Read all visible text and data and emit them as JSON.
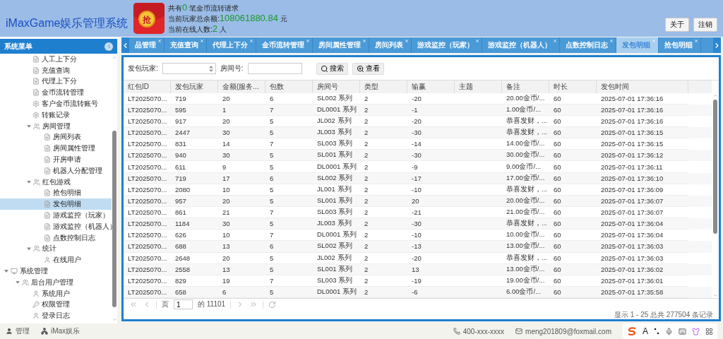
{
  "header": {
    "title": "iMaxGame娱乐管理系统",
    "logo_char": "抢",
    "info": [
      {
        "prefix": "共有",
        "value": "0",
        "suffix": "笔金币流转请求"
      },
      {
        "prefix": "当前玩家总余额:",
        "value": "108061880.84",
        "suffix": "元"
      },
      {
        "prefix": "当前在线人数:",
        "value": "2",
        "suffix": "人"
      }
    ],
    "buttons": [
      "关于",
      "注销"
    ]
  },
  "sidebar": {
    "title": "系统菜单",
    "tree": [
      {
        "children": [
          {
            "label": "人工上下分",
            "kind": "page"
          },
          {
            "label": "充值查询",
            "kind": "page"
          },
          {
            "label": "代理上下分",
            "kind": "page"
          },
          {
            "label": "金币流转管理",
            "kind": "page"
          },
          {
            "label": "客户金币流转账号",
            "kind": "cogs"
          },
          {
            "label": "转账记录",
            "kind": "cogs"
          },
          {
            "label": "房间管理",
            "kind": "group",
            "expanded": true,
            "children": [
              {
                "label": "房间列表",
                "kind": "page",
                "selected": false
              },
              {
                "label": "房间属性管理",
                "kind": "page",
                "selected": false
              },
              {
                "label": "开房申请",
                "kind": "page",
                "selected": false
              },
              {
                "label": "机器人分配管理",
                "kind": "page",
                "selected": false
              }
            ]
          },
          {
            "label": "红包游戏",
            "kind": "group",
            "expanded": true,
            "children": [
              {
                "label": "抢包明细",
                "kind": "page",
                "selected": false
              },
              {
                "label": "发包明细",
                "kind": "page",
                "selected": true
              },
              {
                "label": "游戏监控（玩家）",
                "kind": "page",
                "selected": false
              },
              {
                "label": "游戏监控（机器人）",
                "kind": "page",
                "selected": false
              },
              {
                "label": "点数控制日志",
                "kind": "page",
                "selected": false
              }
            ]
          },
          {
            "label": "统计",
            "kind": "group",
            "expanded": true,
            "children": [
              {
                "label": "在线用户",
                "kind": "user",
                "selected": false
              }
            ]
          }
        ]
      },
      {
        "label": "系统管理",
        "kind": "system",
        "expanded": true,
        "children": [
          {
            "label": "后台用户管理",
            "kind": "group",
            "expanded": true,
            "children": [
              {
                "label": "系统用户",
                "kind": "user",
                "selected": false
              },
              {
                "label": "权限管理",
                "kind": "key",
                "selected": false
              },
              {
                "label": "登录日志",
                "kind": "user",
                "selected": false
              }
            ]
          }
        ]
      }
    ]
  },
  "tabs": [
    {
      "label": "品管理",
      "selected": false
    },
    {
      "label": "充值查询",
      "selected": false
    },
    {
      "label": "代理上下分",
      "selected": false
    },
    {
      "label": "金币流转管理",
      "selected": false
    },
    {
      "label": "房间属性管理",
      "selected": false
    },
    {
      "label": "房间列表",
      "selected": false
    },
    {
      "label": "游戏监控（玩家）",
      "selected": false
    },
    {
      "label": "游戏监控（机器人）",
      "selected": false
    },
    {
      "label": "点数控制日志",
      "selected": false
    },
    {
      "label": "发包明细",
      "selected": true
    },
    {
      "label": "抢包明细",
      "selected": false
    }
  ],
  "filters": {
    "player_label": "发包玩家:",
    "room_label": "房间号:",
    "buttons": [
      {
        "label": "搜索",
        "kind": "search"
      },
      {
        "label": "查看",
        "kind": "view"
      }
    ]
  },
  "table": {
    "columns": [
      "红包ID",
      "发包玩家",
      "金额(服务...",
      "包数",
      "房间号",
      "类型",
      "输赢",
      "主题",
      "备注",
      "时长",
      "发包时间"
    ],
    "rows": [
      [
        "LT2025070...",
        "719",
        "20",
        "6",
        "SL002 系列",
        "2",
        "-20",
        "",
        "20.00金币/...",
        "60",
        "2025-07-01 17:36:16"
      ],
      [
        "LT2025070...",
        "595",
        "1",
        "7",
        "DL0001 系列",
        "2",
        "-1",
        "",
        "1.00金币/...",
        "60",
        "2025-07-01 17:36:16"
      ],
      [
        "LT2025070...",
        "917",
        "20",
        "5",
        "JL002 系列",
        "2",
        "-20",
        "",
        "恭喜发财，...",
        "60",
        "2025-07-01 17:36:16"
      ],
      [
        "LT2025070...",
        "2447",
        "30",
        "5",
        "JL003 系列",
        "2",
        "-30",
        "",
        "恭喜发财，...",
        "60",
        "2025-07-01 17:36:15"
      ],
      [
        "LT2025070...",
        "831",
        "14",
        "7",
        "SL003 系列",
        "2",
        "-14",
        "",
        "14.00金币/...",
        "60",
        "2025-07-01 17:36:15"
      ],
      [
        "LT2025070...",
        "940",
        "30",
        "5",
        "SL001 系列",
        "2",
        "-30",
        "",
        "30.00金币/...",
        "60",
        "2025-07-01 17:36:12"
      ],
      [
        "LT2025070...",
        "611",
        "9",
        "5",
        "DL0001 系列",
        "2",
        "-9",
        "",
        "9.00金币/...",
        "60",
        "2025-07-01 17:36:11"
      ],
      [
        "LT2025070...",
        "719",
        "17",
        "6",
        "SL002 系列",
        "2",
        "-17",
        "",
        "17.00金币/...",
        "60",
        "2025-07-01 17:36:10"
      ],
      [
        "LT2025070...",
        "2080",
        "10",
        "5",
        "JL001 系列",
        "2",
        "-10",
        "",
        "恭喜发财，...",
        "60",
        "2025-07-01 17:36:09"
      ],
      [
        "LT2025070...",
        "957",
        "20",
        "5",
        "SL001 系列",
        "2",
        "20",
        "",
        "20.00金币/...",
        "60",
        "2025-07-01 17:36:07"
      ],
      [
        "LT2025070...",
        "861",
        "21",
        "7",
        "SL003 系列",
        "2",
        "-21",
        "",
        "21.00金币/...",
        "60",
        "2025-07-01 17:36:07"
      ],
      [
        "LT2025070...",
        "1184",
        "30",
        "5",
        "JL003 系列",
        "2",
        "-30",
        "",
        "恭喜发财，...",
        "60",
        "2025-07-01 17:36:04"
      ],
      [
        "LT2025070...",
        "626",
        "10",
        "7",
        "DL0001 系列",
        "2",
        "-10",
        "",
        "10.00金币/...",
        "60",
        "2025-07-01 17:36:04"
      ],
      [
        "LT2025070...",
        "688",
        "13",
        "6",
        "SL002 系列",
        "2",
        "-13",
        "",
        "13.00金币/...",
        "60",
        "2025-07-01 17:36:03"
      ],
      [
        "LT2025070...",
        "2648",
        "20",
        "5",
        "JL002 系列",
        "2",
        "-20",
        "",
        "恭喜发财，...",
        "60",
        "2025-07-01 17:36:03"
      ],
      [
        "LT2025070...",
        "2558",
        "13",
        "5",
        "SL001 系列",
        "2",
        "13",
        "",
        "13.00金币/...",
        "60",
        "2025-07-01 17:36:02"
      ],
      [
        "LT2025070...",
        "829",
        "19",
        "7",
        "SL003 系列",
        "2",
        "-19",
        "",
        "19.00金币/...",
        "60",
        "2025-07-01 17:36:01"
      ],
      [
        "LT2025070...",
        "658",
        "6",
        "5",
        "DL0001 系列",
        "2",
        "-6",
        "",
        "6.00金币/...",
        "60",
        "2025-07-01 17:35:58"
      ]
    ]
  },
  "pager": {
    "page_label": "页",
    "page": "1",
    "of_label": "的 11101",
    "summary": "显示 1 - 25 总共 277504 条记录"
  },
  "footer": {
    "left": [
      {
        "label": "管理",
        "kind": "user"
      },
      {
        "label": "iMax娱乐",
        "kind": "org"
      }
    ],
    "phone": "400-xxx-xxxx",
    "email": "meng201809@foxmail.com",
    "ime_letter": "A"
  }
}
